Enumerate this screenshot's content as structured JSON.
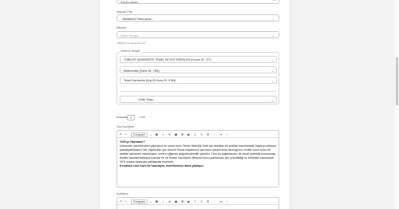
{
  "form": {
    "top_select_value": "Sorunu düzen",
    "micro_label": "Mikroalt Plan",
    "micro_value": "...Mahkemet Hanın şeçin...",
    "etiketler_label": "Etiketler",
    "etiketler_placeholder": "Select Groups...",
    "hint_text": "MEB Bursa Teşvik Baruelt",
    "unite_label": "Ünite/ve Hikaye",
    "rows": [
      "TÜRKİYE ÜNİVERSİTE TEMEL SEVİYE EĞERLER (Kurum ID: 727)",
      "Matematik (Ders ID: 756)",
      "Temel Kavramlar (Kup ID Konu ID: 9784)",
      "",
      "...Ünite Veya..."
    ],
    "puan_label": "Dosyalar",
    "puan_value": "0",
    "puan_max": "/ 100"
  },
  "editor1": {
    "label": "Soru İçeriğiniz",
    "para_label": "Paragraph",
    "content_title": "YKS'ye Hazırlanır?",
    "content_body": "Üniversite hazırlanırken yapmanız ve sonra önce Temel Yeterlilik Testi için eksiksiz bir şekilde hazırlanarak başarıyı kolayca yakalayabilirsiniz! Her öğrencinin çok önemli Sonra başlarsınız tam konu çalıştırılırsa akıcılığımızı verilen konu konu bir şekilde işlenerek hazırlıklarını verilen eğitimini değerlendirebilir yönetici. Tüm bu başlıklarımız ile temel yeterlilik konusunda tesiste hazırlanmaktayız konular ile ve sınavlı hazırlanın! Bireysel konu planlaması için çekebildiği ve bölümleri kazanarak YKS sınava başarıyla yaklaşmak mümkün.",
    "content_bold": "Kendinizi Link Kurs ile hazırlayın, hedeflerinize daha yaklaşın."
  },
  "editor2": {
    "label": "Açıklama",
    "para_label": "Paragraph"
  },
  "colors": {
    "accent_red": "#e03a2f",
    "border": "#c8c8c8"
  },
  "icons": [
    "close-icon",
    "chevron-down-icon",
    "undo-icon",
    "redo-icon",
    "bold-icon",
    "italic-icon",
    "link-icon",
    "image-icon",
    "list-icon"
  ]
}
